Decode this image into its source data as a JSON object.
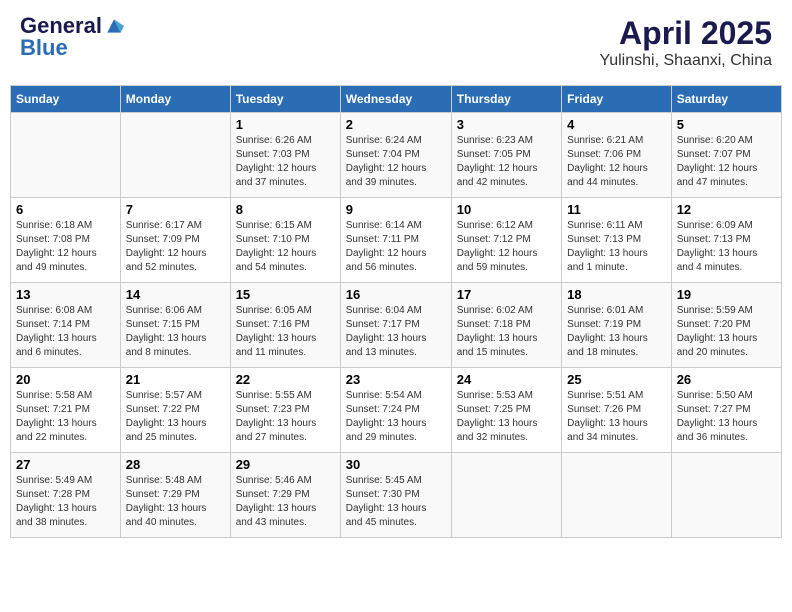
{
  "header": {
    "logo_general": "General",
    "logo_blue": "Blue",
    "month_title": "April 2025",
    "location": "Yulinshi, Shaanxi, China"
  },
  "days_of_week": [
    "Sunday",
    "Monday",
    "Tuesday",
    "Wednesday",
    "Thursday",
    "Friday",
    "Saturday"
  ],
  "weeks": [
    [
      {
        "day": "",
        "info": ""
      },
      {
        "day": "",
        "info": ""
      },
      {
        "day": "1",
        "info": "Sunrise: 6:26 AM\nSunset: 7:03 PM\nDaylight: 12 hours and 37 minutes."
      },
      {
        "day": "2",
        "info": "Sunrise: 6:24 AM\nSunset: 7:04 PM\nDaylight: 12 hours and 39 minutes."
      },
      {
        "day": "3",
        "info": "Sunrise: 6:23 AM\nSunset: 7:05 PM\nDaylight: 12 hours and 42 minutes."
      },
      {
        "day": "4",
        "info": "Sunrise: 6:21 AM\nSunset: 7:06 PM\nDaylight: 12 hours and 44 minutes."
      },
      {
        "day": "5",
        "info": "Sunrise: 6:20 AM\nSunset: 7:07 PM\nDaylight: 12 hours and 47 minutes."
      }
    ],
    [
      {
        "day": "6",
        "info": "Sunrise: 6:18 AM\nSunset: 7:08 PM\nDaylight: 12 hours and 49 minutes."
      },
      {
        "day": "7",
        "info": "Sunrise: 6:17 AM\nSunset: 7:09 PM\nDaylight: 12 hours and 52 minutes."
      },
      {
        "day": "8",
        "info": "Sunrise: 6:15 AM\nSunset: 7:10 PM\nDaylight: 12 hours and 54 minutes."
      },
      {
        "day": "9",
        "info": "Sunrise: 6:14 AM\nSunset: 7:11 PM\nDaylight: 12 hours and 56 minutes."
      },
      {
        "day": "10",
        "info": "Sunrise: 6:12 AM\nSunset: 7:12 PM\nDaylight: 12 hours and 59 minutes."
      },
      {
        "day": "11",
        "info": "Sunrise: 6:11 AM\nSunset: 7:13 PM\nDaylight: 13 hours and 1 minute."
      },
      {
        "day": "12",
        "info": "Sunrise: 6:09 AM\nSunset: 7:13 PM\nDaylight: 13 hours and 4 minutes."
      }
    ],
    [
      {
        "day": "13",
        "info": "Sunrise: 6:08 AM\nSunset: 7:14 PM\nDaylight: 13 hours and 6 minutes."
      },
      {
        "day": "14",
        "info": "Sunrise: 6:06 AM\nSunset: 7:15 PM\nDaylight: 13 hours and 8 minutes."
      },
      {
        "day": "15",
        "info": "Sunrise: 6:05 AM\nSunset: 7:16 PM\nDaylight: 13 hours and 11 minutes."
      },
      {
        "day": "16",
        "info": "Sunrise: 6:04 AM\nSunset: 7:17 PM\nDaylight: 13 hours and 13 minutes."
      },
      {
        "day": "17",
        "info": "Sunrise: 6:02 AM\nSunset: 7:18 PM\nDaylight: 13 hours and 15 minutes."
      },
      {
        "day": "18",
        "info": "Sunrise: 6:01 AM\nSunset: 7:19 PM\nDaylight: 13 hours and 18 minutes."
      },
      {
        "day": "19",
        "info": "Sunrise: 5:59 AM\nSunset: 7:20 PM\nDaylight: 13 hours and 20 minutes."
      }
    ],
    [
      {
        "day": "20",
        "info": "Sunrise: 5:58 AM\nSunset: 7:21 PM\nDaylight: 13 hours and 22 minutes."
      },
      {
        "day": "21",
        "info": "Sunrise: 5:57 AM\nSunset: 7:22 PM\nDaylight: 13 hours and 25 minutes."
      },
      {
        "day": "22",
        "info": "Sunrise: 5:55 AM\nSunset: 7:23 PM\nDaylight: 13 hours and 27 minutes."
      },
      {
        "day": "23",
        "info": "Sunrise: 5:54 AM\nSunset: 7:24 PM\nDaylight: 13 hours and 29 minutes."
      },
      {
        "day": "24",
        "info": "Sunrise: 5:53 AM\nSunset: 7:25 PM\nDaylight: 13 hours and 32 minutes."
      },
      {
        "day": "25",
        "info": "Sunrise: 5:51 AM\nSunset: 7:26 PM\nDaylight: 13 hours and 34 minutes."
      },
      {
        "day": "26",
        "info": "Sunrise: 5:50 AM\nSunset: 7:27 PM\nDaylight: 13 hours and 36 minutes."
      }
    ],
    [
      {
        "day": "27",
        "info": "Sunrise: 5:49 AM\nSunset: 7:28 PM\nDaylight: 13 hours and 38 minutes."
      },
      {
        "day": "28",
        "info": "Sunrise: 5:48 AM\nSunset: 7:29 PM\nDaylight: 13 hours and 40 minutes."
      },
      {
        "day": "29",
        "info": "Sunrise: 5:46 AM\nSunset: 7:29 PM\nDaylight: 13 hours and 43 minutes."
      },
      {
        "day": "30",
        "info": "Sunrise: 5:45 AM\nSunset: 7:30 PM\nDaylight: 13 hours and 45 minutes."
      },
      {
        "day": "",
        "info": ""
      },
      {
        "day": "",
        "info": ""
      },
      {
        "day": "",
        "info": ""
      }
    ]
  ]
}
